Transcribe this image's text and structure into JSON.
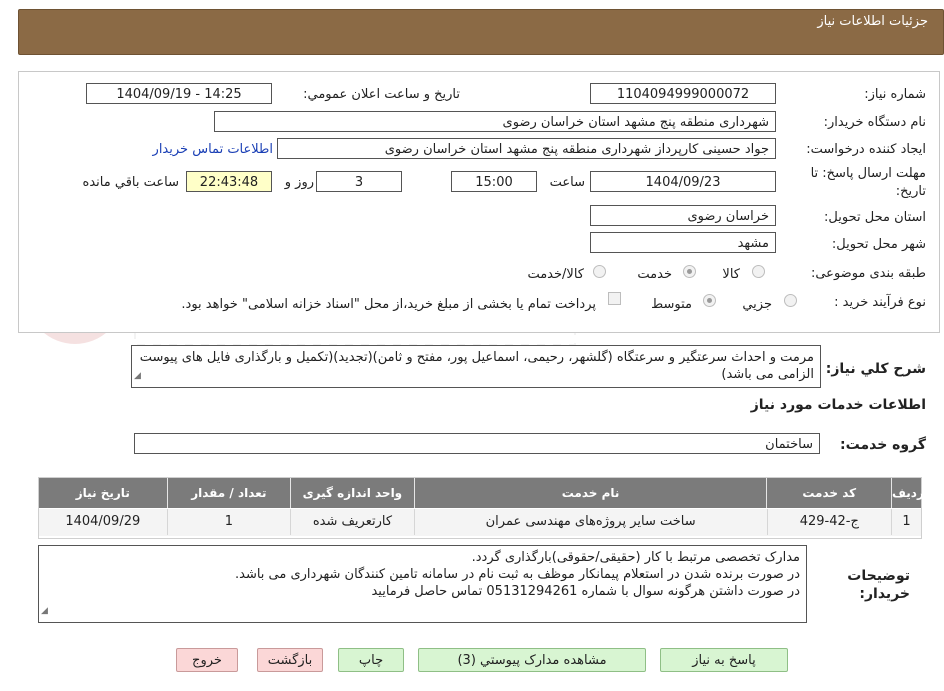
{
  "header": {
    "title": "جزئیات اطلاعات نیاز"
  },
  "fields": {
    "need_number": {
      "label": "شماره نیاز:",
      "value": "1104094999000072"
    },
    "announce_datetime": {
      "label": "تاریخ و ساعت اعلان عمومي:",
      "value": "1404/09/19 - 14:25"
    },
    "buyer_org": {
      "label": "نام دستگاه خريدار:",
      "value": "شهرداری منطقه پنج مشهد استان خراسان رضوی"
    },
    "requester": {
      "label": "ايجاد کننده درخواست:",
      "value": "جواد حسینی کارپرداز شهرداری منطقه پنج مشهد استان خراسان رضوی",
      "contact_link": "اطلاعات تماس خريدار"
    },
    "deadline": {
      "label_line1": "مهلت ارسال پاسخ: تا",
      "label_line2": "تاريخ:",
      "date": "1404/09/23",
      "time_label": "ساعت",
      "time": "15:00",
      "days": "3",
      "days_label": "روز و",
      "remaining": "22:43:48",
      "remaining_label": "ساعت باقي مانده"
    },
    "delivery_province": {
      "label": "استان محل تحويل:",
      "value": "خراسان رضوی"
    },
    "delivery_city": {
      "label": "شهر محل تحويل:",
      "value": "مشهد"
    },
    "category": {
      "label": "طبقه بندی موضوعی:",
      "options": [
        "کالا",
        "خدمت",
        "کالا/خدمت"
      ],
      "selected": "خدمت"
    },
    "purchase_process": {
      "label": "نوع فرآيند خريد :",
      "options": [
        "جزيي",
        "متوسط"
      ],
      "selected": "متوسط",
      "note": "پرداخت تمام یا بخشی از مبلغ خرید،از محل \"اسناد خزانه اسلامی\" خواهد بود."
    }
  },
  "summary": {
    "label": "شرح کلي نياز:",
    "text": "مرمت و احداث سرعتگیر و سرعتگاه (گلشهر، رحیمی، اسماعیل پور، مفتح و ثامن)(تجدید)(تکمیل و بارگذاری فایل های پیوست الزامی می باشد)"
  },
  "services_section": {
    "title": "اطلاعات خدمات مورد نياز"
  },
  "service_group": {
    "label": "گروه خدمت:",
    "value": "ساختمان"
  },
  "table": {
    "headers": [
      "رديف",
      "کد خدمت",
      "نام خدمت",
      "واحد اندازه گيری",
      "تعداد / مقدار",
      "تاريخ نياز"
    ],
    "rows": [
      [
        "1",
        "ج-42-429",
        "ساخت سایر پروژه‌های مهندسی عمران",
        "کارتعریف شده",
        "1",
        "1404/09/29"
      ]
    ]
  },
  "buyer_notes": {
    "label_line1": "توضيحات",
    "label_line2": "خريدار:",
    "lines": [
      "مدارک تخصصی مرتبط با کار (حقیقی/حقوقی)بارگذاری گردد.",
      "در صورت برنده شدن در استعلام پیمانکار موظف به ثبت نام در سامانه تامین کنندگان شهرداری می باشد.",
      "در صورت داشتن هرگونه سوال  با شماره 05131294261 تماس حاصل فرمایید"
    ]
  },
  "buttons": {
    "reply": "پاسخ به نياز",
    "view_docs": "مشاهده مدارک پيوستي (3)",
    "print": "چاپ",
    "back": "بازگشت",
    "exit": "خروج"
  },
  "colors": {
    "header_bg": "#8b6a45",
    "table_header_bg": "#7b7b7b",
    "highlight": "#ffffc8"
  }
}
